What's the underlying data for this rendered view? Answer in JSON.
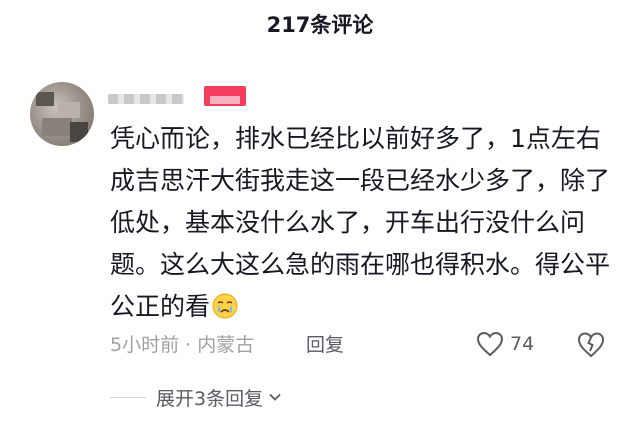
{
  "header": {
    "title": "217条评论"
  },
  "comment": {
    "text": "凭心而论，排水已经比以前好多了，1点左右成吉思汗大街我走这一段已经水少多了，除了低处，基本没什么水了，开车出行没什么问题。这么大这么急的雨在哪也得积水。得公平公正的看",
    "emoji_icon": "crying-face-icon",
    "time_location": "5小时前 · 内蒙古",
    "reply_label": "回复",
    "like_count": "74"
  },
  "replies": {
    "expand_label": "展开3条回复"
  },
  "colors": {
    "primary_text": "#161823",
    "secondary_text": "#a0a1a6",
    "action_text": "#5a5b63",
    "badge": "#f53d5f"
  }
}
